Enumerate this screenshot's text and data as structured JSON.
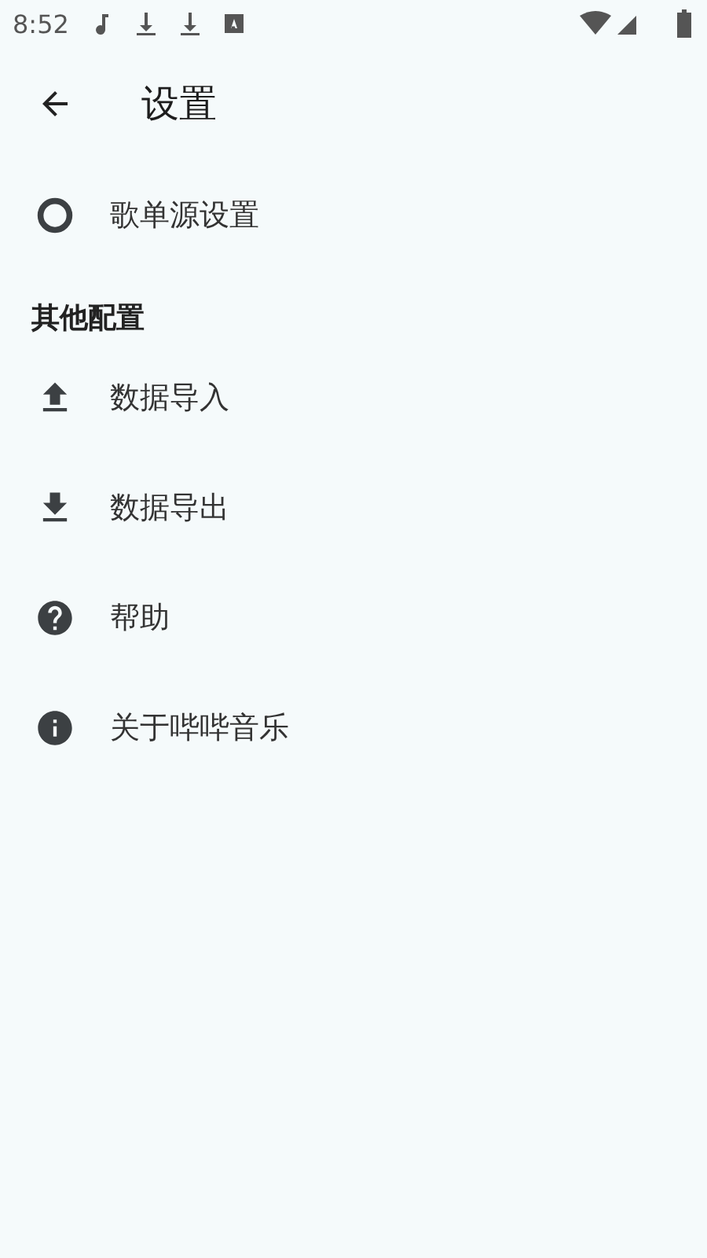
{
  "status_bar": {
    "time": "8:52"
  },
  "toolbar": {
    "title": "设置"
  },
  "items": [
    {
      "kind": "ring",
      "label": "歌单源设置"
    }
  ],
  "sections": [
    {
      "header": "其他配置",
      "items": [
        {
          "kind": "upload",
          "label": "数据导入"
        },
        {
          "kind": "download",
          "label": "数据导出"
        },
        {
          "kind": "help",
          "label": "帮助"
        },
        {
          "kind": "info",
          "label": "关于哔哔音乐"
        }
      ]
    }
  ]
}
